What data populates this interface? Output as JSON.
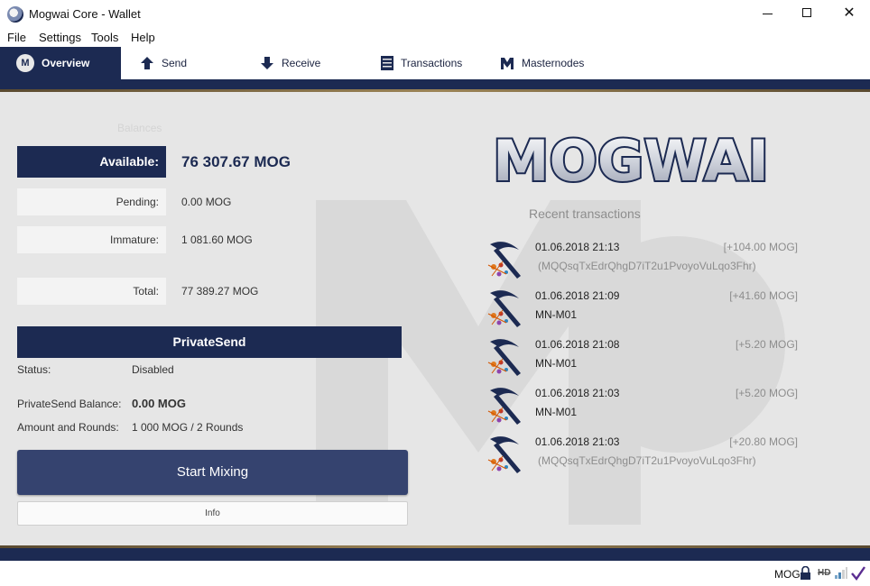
{
  "window": {
    "title": "Mogwai Core - Wallet",
    "minimize": "—",
    "maximize": "☐",
    "close": "✕"
  },
  "menu": [
    "File",
    "Settings",
    "Tools",
    "Help"
  ],
  "tabs": [
    {
      "label": "Overview",
      "icon": "mogwai-logo-icon",
      "active": true
    },
    {
      "label": "Send",
      "icon": "arrow-up-icon"
    },
    {
      "label": "Receive",
      "icon": "arrow-down-icon"
    },
    {
      "label": "Transactions",
      "icon": "list-icon"
    },
    {
      "label": "Masternodes",
      "icon": "masternode-icon"
    }
  ],
  "balances": {
    "ghost_label": "Balances",
    "available_label": "Available:",
    "available_value": "76 307.67 MOG",
    "pending_label": "Pending:",
    "pending_value": "0.00 MOG",
    "immature_label": "Immature:",
    "immature_value": "1 081.60 MOG",
    "total_label": "Total:",
    "total_value": "77 389.27 MOG"
  },
  "privatesend": {
    "header": "PrivateSend",
    "status_label": "Status:",
    "status_value": "Disabled",
    "balance_label": "PrivateSend Balance:",
    "balance_value": "0.00 MOG",
    "rounds_label": "Amount and Rounds:",
    "rounds_value": "1 000 MOG / 2 Rounds",
    "start_button": "Start Mixing",
    "info_button": "Info"
  },
  "logo_text": "MOGWAI",
  "recent": {
    "title": "Recent transactions",
    "items": [
      {
        "date": "01.06.2018 21:13",
        "amount": "[+104.00 MOG]",
        "address": "(MQQsqTxEdrQhgD7iT2u1PvoyoVuLqo3Fhr)"
      },
      {
        "date": "01.06.2018 21:09",
        "amount": "[+41.60 MOG]",
        "address": "MN-M01"
      },
      {
        "date": "01.06.2018 21:08",
        "amount": "[+5.20 MOG]",
        "address": "MN-M01"
      },
      {
        "date": "01.06.2018 21:03",
        "amount": "[+5.20 MOG]",
        "address": "MN-M01"
      },
      {
        "date": "01.06.2018 21:03",
        "amount": "[+20.80 MOG]",
        "address": "(MQQsqTxEdrQhgD7iT2u1PvoyoVuLqo3Fhr)"
      }
    ]
  },
  "statusbar": {
    "unit": "MOG",
    "hd_label": "HD"
  },
  "colors": {
    "navy": "#1c2a52",
    "button": "#35436f",
    "background": "#e6e6e6"
  }
}
